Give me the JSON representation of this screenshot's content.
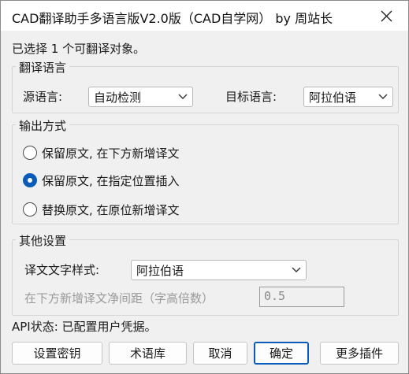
{
  "window": {
    "title": "CAD翻译助手多语言版V2.0版（CAD自学网） by 周站长"
  },
  "selection_status": "已选择 1 个可翻译对象。",
  "translate_language": {
    "group_title": "翻译语言",
    "source_label": "源语言:",
    "source_value": "自动检测",
    "target_label": "目标语言:",
    "target_value": "阿拉伯语"
  },
  "output_mode": {
    "group_title": "输出方式",
    "options": [
      {
        "label": "保留原文, 在下方新增译文",
        "checked": false
      },
      {
        "label": "保留原文, 在指定位置插入",
        "checked": true
      },
      {
        "label": "替换原文, 在原位新增译文",
        "checked": false
      }
    ]
  },
  "other_settings": {
    "group_title": "其他设置",
    "style_label": "译文文字样式:",
    "style_value": "阿拉伯语",
    "spacing_label": "在下方新增译文净间距（字高倍数）",
    "spacing_value": "0.5",
    "spacing_enabled": false
  },
  "api_status": "API状态: 已配置用户凭据。",
  "buttons": {
    "set_key": "设置密钥",
    "glossary": "术语库",
    "cancel": "取消",
    "ok": "确定",
    "more_plugins": "更多插件"
  },
  "colors": {
    "accent": "#0a5cb8",
    "window_bg": "#f0f0f0",
    "titlebar_bg": "#ffffff"
  },
  "icons": {
    "close": "close-icon",
    "dropdown": "chevron-down-icon"
  }
}
